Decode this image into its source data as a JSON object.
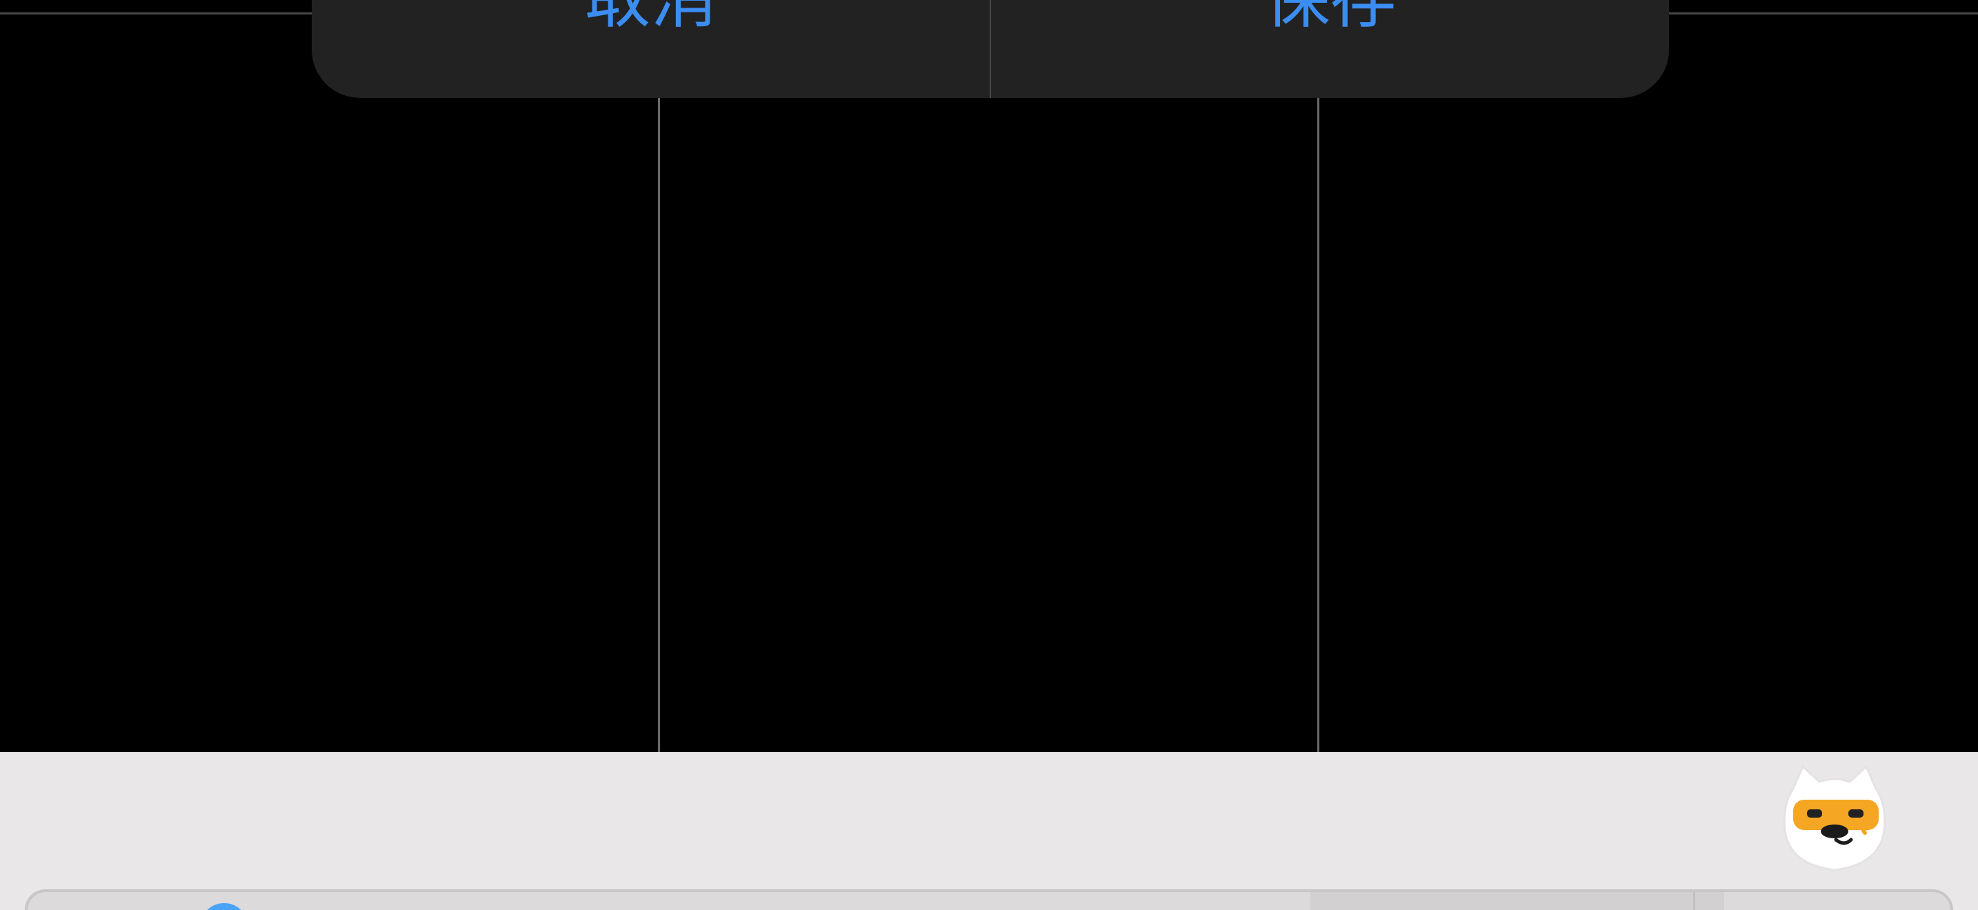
{
  "action_sheet": {
    "cancel_label": "取消",
    "save_label": "保存"
  },
  "colors": {
    "accent": "#3b8df2",
    "sheet_background": "#222222",
    "viewport_background": "#000000",
    "bottom_background": "#e9e7e8",
    "mascot_primary": "#f5a623"
  },
  "icons": {
    "mascot": "mascot-assistant-icon",
    "bar_indicator": "blue-dot-indicator"
  }
}
